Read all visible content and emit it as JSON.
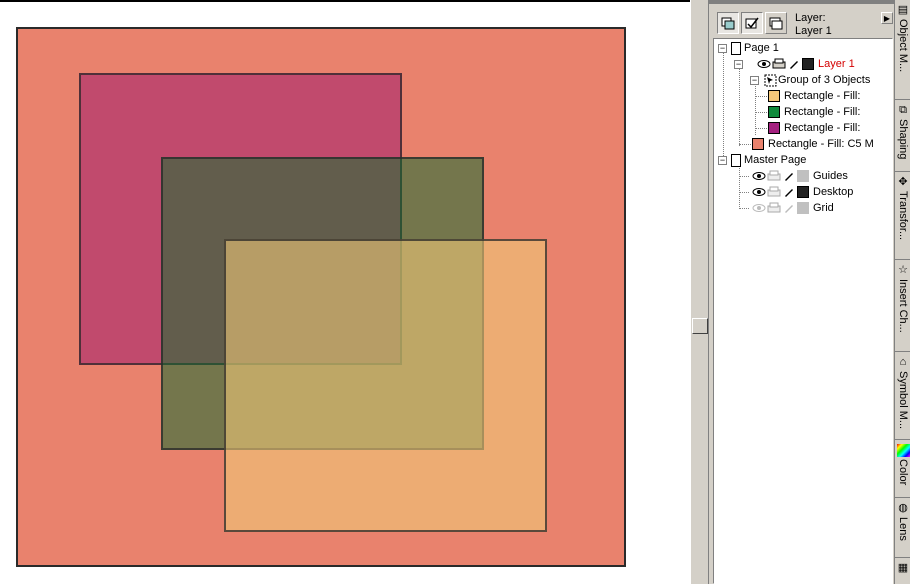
{
  "canvas": {
    "shapes": [
      {
        "name": "background-rectangle",
        "fill": "#e9826d"
      },
      {
        "name": "purple-rectangle",
        "fill": "rgba(160,30,110,0.55)"
      },
      {
        "name": "green-rectangle",
        "fill": "rgba(20,110,50,0.55)"
      },
      {
        "name": "yellow-rectangle",
        "fill": "rgba(240,200,120,0.6)"
      }
    ]
  },
  "panel": {
    "layer_label": "Layer:",
    "layer_name": "Layer 1",
    "tree": {
      "page1": "Page 1",
      "layer1": "Layer 1",
      "group": "Group of 3 Objects",
      "rect_yellow": "Rectangle - Fill:",
      "rect_green": "Rectangle - Fill:",
      "rect_purple": "Rectangle - Fill:",
      "rect_bg": "Rectangle - Fill: C5 M",
      "master": "Master Page",
      "guides": "Guides",
      "desktop": "Desktop",
      "grid": "Grid"
    },
    "swatches": {
      "layer1": "#222222",
      "yellow": "#f6c97a",
      "green": "#0f8a3c",
      "purple": "#a3207f",
      "bg": "#e9826d",
      "guides": "#c0c0c0",
      "desktop": "#222222",
      "grid": "#c0c0c0"
    }
  },
  "dock": {
    "tabs": [
      "Object M...",
      "Shaping",
      "Transfor...",
      "Insert Ch...",
      "Symbol M...",
      "Color",
      "Lens"
    ],
    "icons": [
      "object-manager-icon",
      "shaping-icon",
      "transform-icon",
      "insert-character-icon",
      "symbol-manager-icon",
      "color-icon",
      "lens-icon"
    ]
  }
}
